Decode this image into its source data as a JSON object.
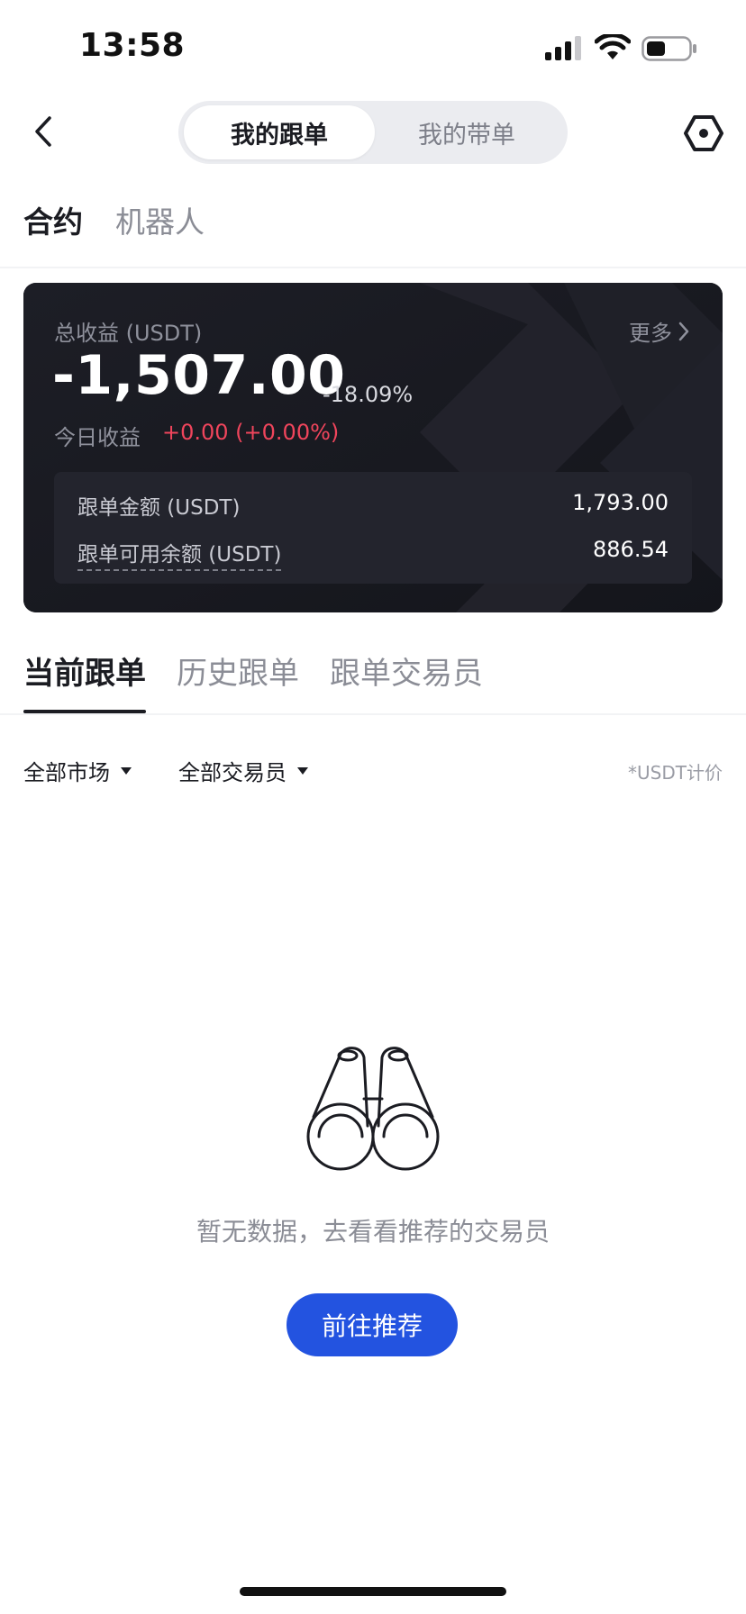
{
  "status_bar": {
    "time": "13:58",
    "icons": [
      "signal-icon",
      "wifi-icon",
      "battery-icon"
    ]
  },
  "nav": {
    "back_icon": "chevron-left-icon",
    "segments": [
      {
        "label": "我的跟单",
        "active": true
      },
      {
        "label": "我的带单",
        "active": false
      }
    ],
    "settings_icon": "hexagon-settings-icon"
  },
  "category_tabs": [
    {
      "label": "合约",
      "active": true
    },
    {
      "label": "机器人",
      "active": false
    }
  ],
  "summary_card": {
    "total_label": "总收益 (USDT)",
    "more_label": "更多",
    "total_value": "-1,507.00",
    "total_pct": "-18.09%",
    "today_label": "今日收益",
    "today_value": "+0.00 (+0.00%)",
    "rows": [
      {
        "label": "跟单金额 (USDT)",
        "value": "1,793.00"
      },
      {
        "label": "跟单可用余额 (USDT)",
        "value": "886.54"
      }
    ]
  },
  "order_tabs": [
    {
      "label": "当前跟单",
      "active": true
    },
    {
      "label": "历史跟单",
      "active": false
    },
    {
      "label": "跟单交易员",
      "active": false
    }
  ],
  "filters": {
    "market": "全部市场",
    "trader": "全部交易员",
    "unit_note": "*USDT计价"
  },
  "empty_state": {
    "icon": "binoculars-icon",
    "message": "暂无数据，去看看推荐的交易员",
    "button_label": "前往推荐"
  },
  "colors": {
    "accent": "#2353e0",
    "negative": "#f0455c",
    "card_bg": "#1a1b22"
  }
}
